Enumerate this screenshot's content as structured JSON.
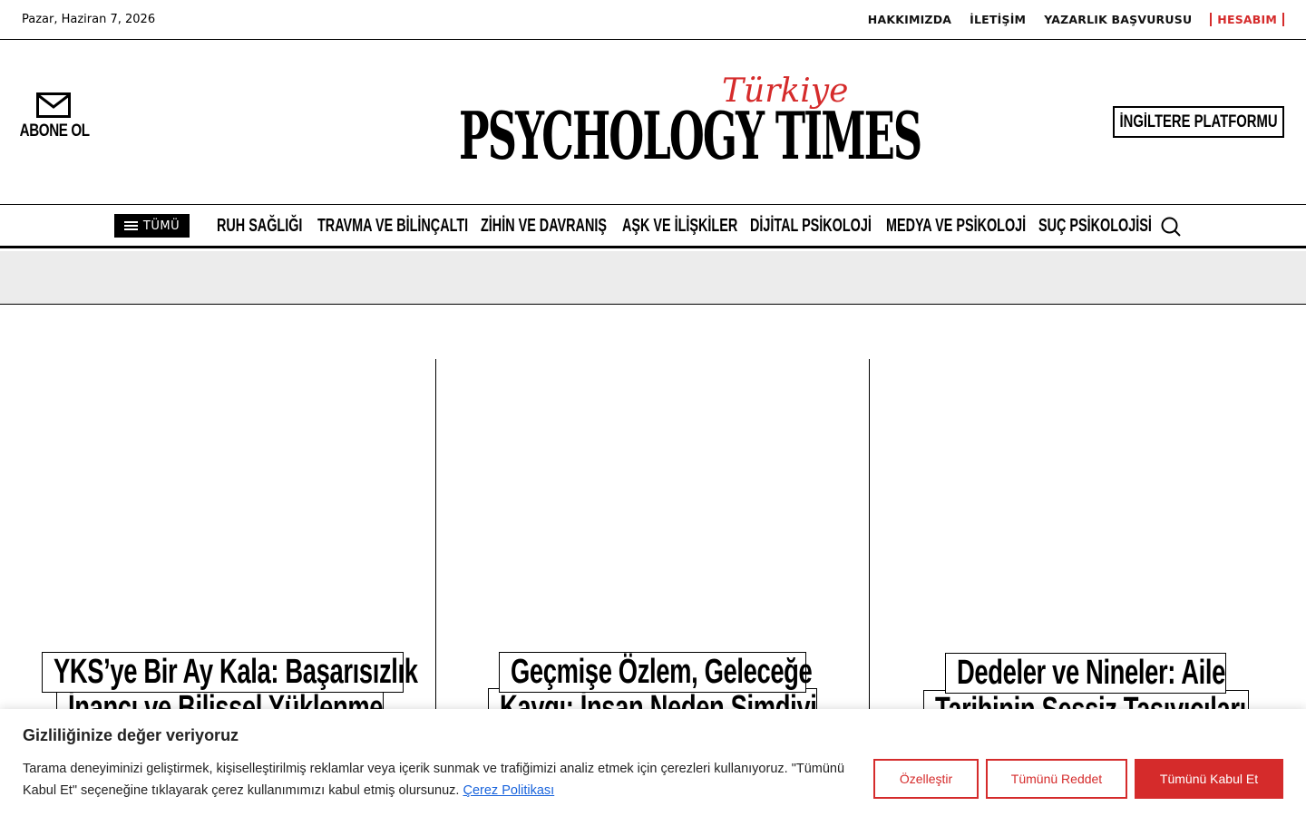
{
  "topbar": {
    "date": "Pazar, Haziran 7, 2026",
    "links": [
      "HAKKIMIZDA",
      "İLETİŞİM",
      "YAZARLIK BAŞVURUSU"
    ],
    "account": "HESABIM"
  },
  "header": {
    "subscribe_label": "ABONE OL",
    "logo_main": "PSYCHOLOGY TIMES",
    "logo_script": "Türkiye",
    "uk_platform": "İNGİLTERE PLATFORMU"
  },
  "nav": {
    "all_label": "TÜMÜ",
    "items": [
      "RUH SAĞLIĞI",
      "TRAVMA VE BİLİNÇALTI",
      "ZİHİN VE DAVRANIŞ",
      "AŞK VE İLİŞKİLER",
      "DİJİTAL PSİKOLOJİ",
      "MEDYA VE PSİKOLOJİ",
      "SUÇ PSİKOLOJİSİ"
    ]
  },
  "articles": [
    {
      "line1": "YKS’ye Bir Ay Kala: Başarısızlık",
      "line2": "İnancı ve Bilişsel Yüklenme"
    },
    {
      "line1": "Geçmişe Özlem, Geleceğe",
      "line2": "Kaygı: İnsan Neden Şimdiyi"
    },
    {
      "line1": "Dedeler ve Nineler: Aile",
      "line2": "Tarihinin Sessiz Taşıyıcıları"
    }
  ],
  "cookie": {
    "title": "Gizliliğinize değer veriyoruz",
    "text": "Tarama deneyiminizi geliştirmek, kişiselleştirilmiş reklamlar veya içerik sunmak ve trafiğimizi analiz etmek için çerezleri kullanıyoruz. \"Tümünü Kabul Et\" seçeneğine tıklayarak çerez kullanımımızı kabul etmiş olursunuz.",
    "policy_link": "Çerez Politikası",
    "customize": "Özelleştir",
    "reject": "Tümünü Reddet",
    "accept": "Tümünü Kabul Et"
  },
  "colors": {
    "accent": "#d52b2b",
    "link": "#1863dc"
  }
}
